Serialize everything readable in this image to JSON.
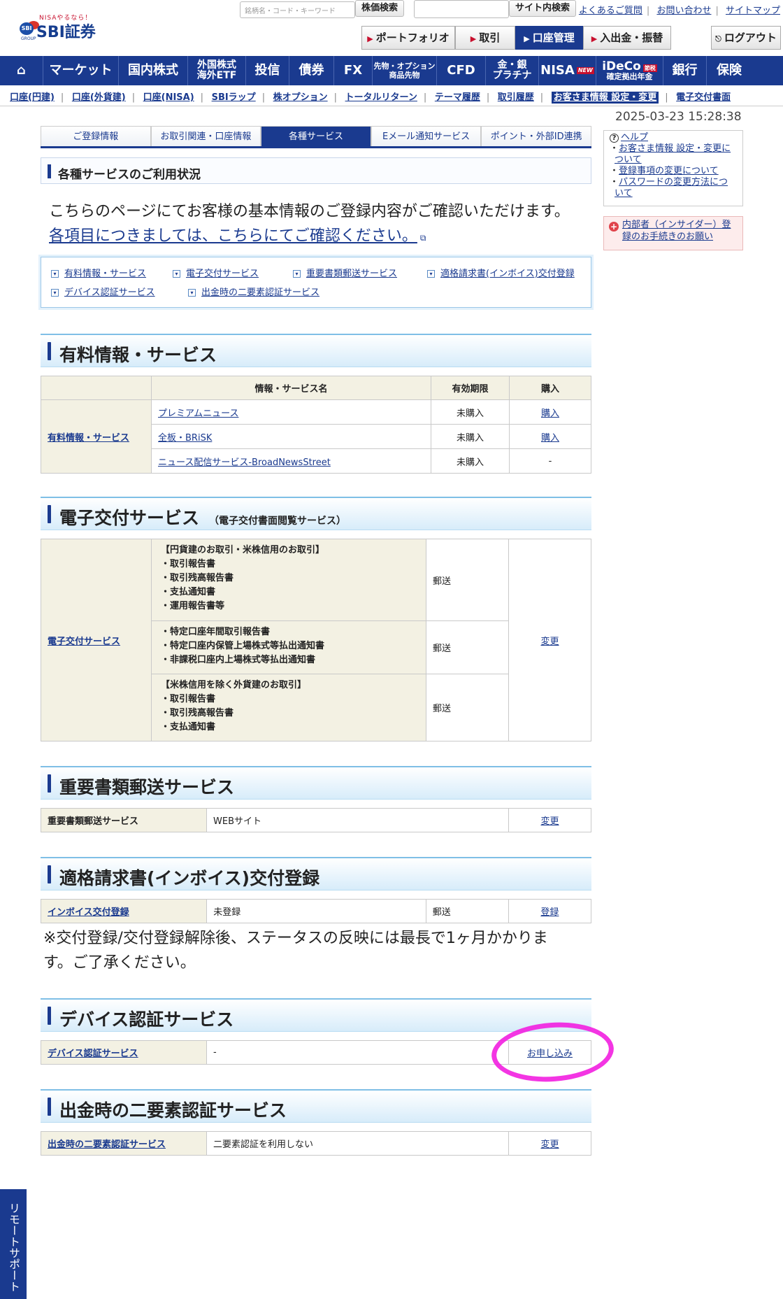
{
  "header": {
    "logo_tag": "NISAやるなら！",
    "logo_name": "SBI証券",
    "logo_mark": "SBI",
    "logo_group": "GROUP",
    "search_placeholder": "銘柄名・コード・キーワード",
    "search_button": "株価検索",
    "site_search_button": "サイト内検索",
    "links": [
      "よくあるご質問",
      "お問い合わせ",
      "サイトマップ"
    ],
    "tabs": [
      "ポートフォリオ",
      "取引",
      "口座管理",
      "入出金・振替"
    ],
    "logout": "ログアウト"
  },
  "global_nav": [
    {
      "l1": "マーケット"
    },
    {
      "l1": "国内株式"
    },
    {
      "l1": "外国株式",
      "l2": "海外ETF"
    },
    {
      "l1": "投信"
    },
    {
      "l1": "債券"
    },
    {
      "l1": "FX"
    },
    {
      "l1": "先物・オプション",
      "l2": "商品先物"
    },
    {
      "l1": "CFD"
    },
    {
      "l1": "金・銀",
      "l2": "プラチナ"
    },
    {
      "l1": "NISA",
      "badge": "NEW"
    },
    {
      "l1": "iDeCo",
      "badge": "節税",
      "l2": "確定拠出年金"
    },
    {
      "l1": "銀行"
    },
    {
      "l1": "保険"
    }
  ],
  "sub_nav": [
    "口座(円建)",
    "口座(外貨建)",
    "口座(NISA)",
    "SBIラップ",
    "株オプション",
    "トータルリターン",
    "テーマ履歴",
    "取引履歴",
    "お客さま情報 設定・変更",
    "電子交付書面"
  ],
  "datetime": "2025-03-23 15:28:38",
  "page_tabs": [
    "ご登録情報",
    "お取引関連・口座情報",
    "各種サービス",
    "Eメール通知サービス",
    "ポイント・外部ID連携"
  ],
  "section_title": "各種サービスのご利用状況",
  "intro_line1": "こちらのページにてお客様の基本情報のご登録内容がご確認いただけます。",
  "intro_link": "各項目につきましては、こちらにてご確認ください。",
  "anchors": [
    "有料情報・サービス",
    "電子交付サービス",
    "重要書類郵送サービス",
    "適格請求書(インボイス)交付登録",
    "デバイス認証サービス",
    "出金時の二要素認証サービス"
  ],
  "paid": {
    "title": "有料情報・サービス",
    "headers": [
      "情報・サービス名",
      "有効期限",
      "購入"
    ],
    "label": "有料情報・サービス",
    "rows": [
      {
        "name": "プレミアムニュース",
        "status": "未購入",
        "action": "購入"
      },
      {
        "name": "全板・BRiSK",
        "status": "未購入",
        "action": "購入"
      },
      {
        "name": "ニュース配信サービス-BroadNewsStreet",
        "status": "未購入",
        "action": "-"
      }
    ]
  },
  "edelivery": {
    "title": "電子交付サービス",
    "note": "（電子交付書面閲覧サービス）",
    "label": "電子交付サービス",
    "rows": [
      {
        "lines": [
          "【円貨建のお取引・米株信用のお取引】",
          "・取引報告書",
          "・取引残高報告書",
          "・支払通知書",
          "・運用報告書等"
        ],
        "value": "郵送"
      },
      {
        "lines": [
          "・特定口座年間取引報告書",
          "・特定口座内保管上場株式等払出通知書",
          "・非課税口座内上場株式等払出通知書"
        ],
        "value": "郵送"
      },
      {
        "lines": [
          "【米株信用を除く外貨建のお取引】",
          "・取引報告書",
          "・取引残高報告書",
          "・支払通知書"
        ],
        "value": "郵送"
      }
    ],
    "action": "変更"
  },
  "mail": {
    "title": "重要書類郵送サービス",
    "label": "重要書類郵送サービス",
    "value": "WEBサイト",
    "action": "変更"
  },
  "invoice": {
    "title": "適格請求書(インボイス)交付登録",
    "label": "インボイス交付登録",
    "value": "未登録",
    "method": "郵送",
    "action": "登録",
    "note": "※交付登録/交付登録解除後、ステータスの反映には最長で1ヶ月かかります。ご了承ください。"
  },
  "device": {
    "title": "デバイス認証サービス",
    "label": "デバイス認証サービス",
    "value": "-",
    "action": "お申し込み"
  },
  "twofactor": {
    "title": "出金時の二要素認証サービス",
    "label": "出金時の二要素認証サービス",
    "value": "二要素認証を利用しない",
    "action": "変更"
  },
  "sidebar": {
    "help": "ヘルプ",
    "links": [
      "お客さま情報 設定・変更について",
      "登録事項の変更について",
      "パスワードの変更方法について"
    ],
    "insider": "内部者（インサイダー）登録のお手続きのお願い"
  },
  "remote_support": "リモートサポート",
  "colors": {
    "brand": "#1a3a8f",
    "highlight": "#f21fe0"
  }
}
